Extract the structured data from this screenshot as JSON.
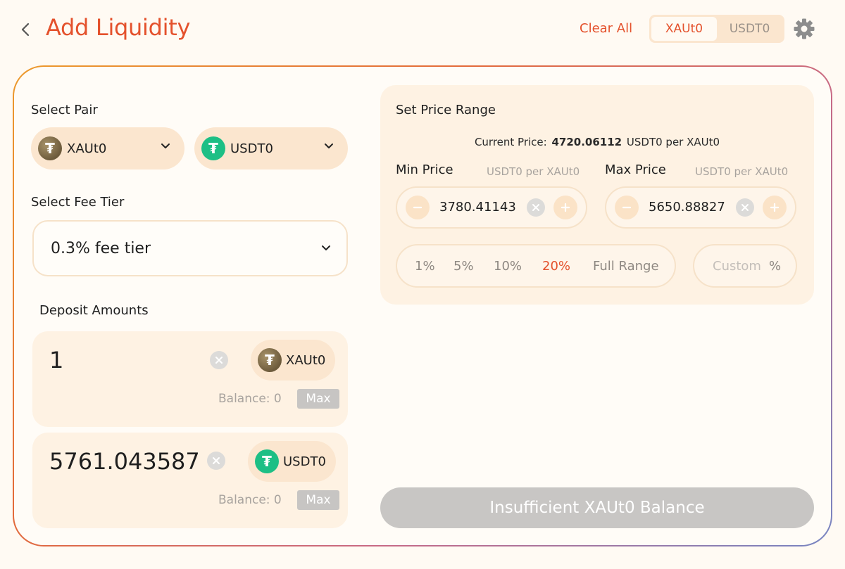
{
  "header": {
    "title": "Add Liquidity",
    "clear_all": "Clear All",
    "toggle": [
      {
        "label": "XAUt0",
        "active": true
      },
      {
        "label": "USDT0",
        "active": false
      }
    ],
    "icons": {
      "back": "chevron-left-icon",
      "settings": "gear-icon"
    }
  },
  "pair": {
    "label": "Select Pair",
    "token_a": {
      "symbol": "XAUt0",
      "icon": "xaut0-token-icon"
    },
    "token_b": {
      "symbol": "USDT0",
      "icon": "usdt0-token-icon"
    }
  },
  "fee": {
    "label": "Select Fee Tier",
    "selected": "0.3% fee tier"
  },
  "deposit": {
    "label": "Deposit Amounts",
    "inputs": [
      {
        "value": "1",
        "token": "XAUt0",
        "balance": "Balance: 0",
        "max": "Max"
      },
      {
        "value": "5761.043587",
        "token": "USDT0",
        "balance": "Balance: 0",
        "max": "Max"
      }
    ]
  },
  "price_range": {
    "label": "Set Price Range",
    "current_label": "Current Price:",
    "current_value": "4720.06112",
    "current_unit": "USDT0 per XAUt0",
    "min": {
      "label": "Min Price",
      "unit": "USDT0 per XAUt0",
      "value": "3780.41143"
    },
    "max": {
      "label": "Max Price",
      "unit": "USDT0 per XAUt0",
      "value": "5650.88827"
    },
    "options": [
      "1%",
      "5%",
      "10%",
      "20%",
      "Full Range"
    ],
    "active_option": "20%",
    "custom_placeholder": "Custom",
    "custom_suffix": "%"
  },
  "submit": {
    "label": "Insufficient XAUt0 Balance",
    "disabled": true
  },
  "colors": {
    "accent": "#e4512c",
    "background": "#fffaf3",
    "panel": "#fef2e3",
    "pill": "#fbe6cf",
    "usdt_green": "#1dbf85",
    "disabled": "#c8c6c4"
  }
}
